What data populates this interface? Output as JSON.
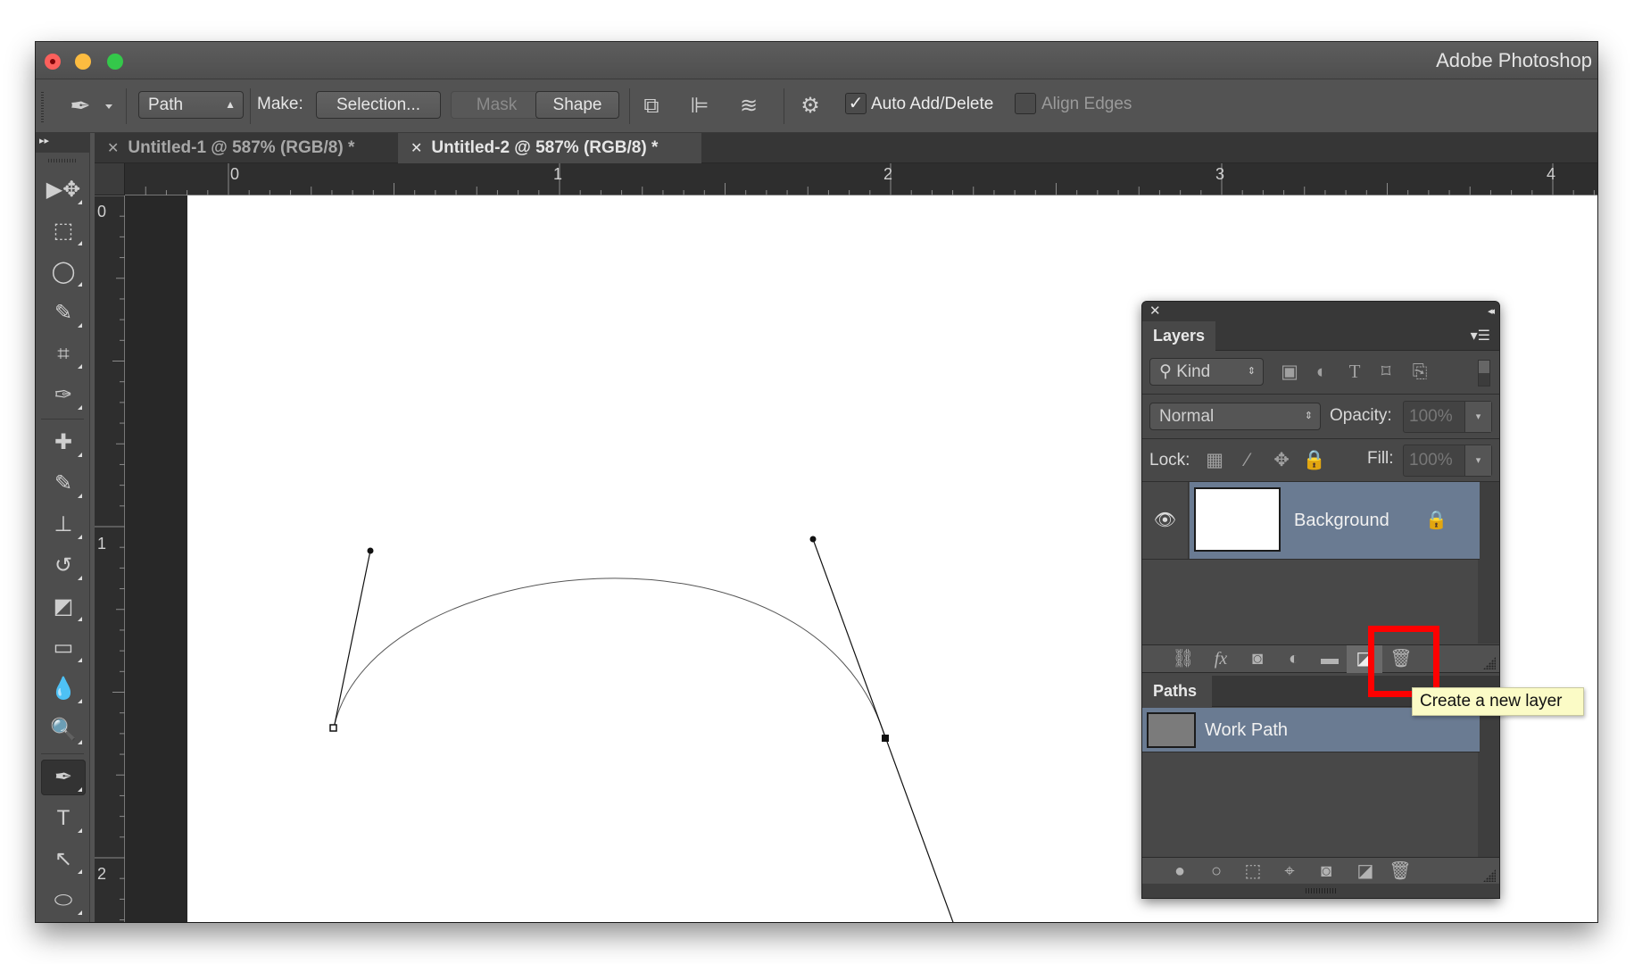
{
  "window": {
    "app_title": "Adobe Photoshop"
  },
  "options_bar": {
    "tool_icon": "pen-icon",
    "mode_select": "Path",
    "make_label": "Make:",
    "selection_button": "Selection...",
    "mask_button": "Mask",
    "shape_button": "Shape",
    "path_operations_icon": "path-operations-icon",
    "path_alignment_icon": "path-alignment-icon",
    "path_arrangement_icon": "path-arrangement-icon",
    "settings_icon": "gear-icon",
    "auto_add_delete": {
      "label": "Auto Add/Delete",
      "checked": true
    },
    "align_edges": {
      "label": "Align Edges",
      "checked": false
    }
  },
  "document_tabs": [
    {
      "label": "Untitled-1 @ 587% (RGB/8) *",
      "active": false
    },
    {
      "label": "Untitled-2 @ 587% (RGB/8) *",
      "active": true
    }
  ],
  "rulers": {
    "horizontal": [
      "0",
      "1",
      "2",
      "3",
      "4"
    ],
    "vertical": [
      "0",
      "1",
      "2"
    ]
  },
  "tools": [
    {
      "name": "move-tool",
      "glyph": "▶✥"
    },
    {
      "name": "rectangular-marquee-tool",
      "glyph": "⬚"
    },
    {
      "name": "lasso-tool",
      "glyph": "◯"
    },
    {
      "name": "quick-selection-tool",
      "glyph": "✎"
    },
    {
      "name": "crop-tool",
      "glyph": "⌗"
    },
    {
      "name": "eyedropper-tool",
      "glyph": "✑"
    },
    {
      "name": "spot-healing-brush-tool",
      "glyph": "✚"
    },
    {
      "name": "brush-tool",
      "glyph": "✎"
    },
    {
      "name": "clone-stamp-tool",
      "glyph": "⊥"
    },
    {
      "name": "history-brush-tool",
      "glyph": "↺"
    },
    {
      "name": "eraser-tool",
      "glyph": "◩"
    },
    {
      "name": "gradient-tool",
      "glyph": "▭"
    },
    {
      "name": "blur-tool",
      "glyph": "💧"
    },
    {
      "name": "dodge-tool",
      "glyph": "🔍"
    },
    {
      "name": "pen-tool",
      "glyph": "✒",
      "active": true
    },
    {
      "name": "type-tool",
      "glyph": "T"
    },
    {
      "name": "path-selection-tool",
      "glyph": "↖"
    },
    {
      "name": "ellipse-tool",
      "glyph": "⬭"
    }
  ],
  "layers_panel": {
    "tab_label": "Layers",
    "filter_kind": "Kind",
    "blend_mode": "Normal",
    "opacity_label": "Opacity:",
    "opacity_value": "100%",
    "lock_label": "Lock:",
    "fill_label": "Fill:",
    "fill_value": "100%",
    "layers": [
      {
        "name": "Background",
        "visible": true,
        "locked": true,
        "selected": true
      }
    ],
    "footer_buttons": [
      "link-layers",
      "add-layer-style",
      "add-layer-mask",
      "new-fill-adjustment-layer",
      "new-group",
      "create-new-layer",
      "delete-layer"
    ],
    "highlighted_button": "create-new-layer"
  },
  "paths_panel": {
    "tab_label": "Paths",
    "paths": [
      {
        "name": "Work Path",
        "selected": true
      }
    ],
    "footer_buttons": [
      "fill-path",
      "stroke-path",
      "load-path-as-selection",
      "make-work-path",
      "add-mask",
      "create-new-path",
      "delete-path"
    ]
  },
  "tooltip": {
    "text": "Create a new layer"
  },
  "annotation": {
    "type": "highlight-box",
    "color": "#ff0000",
    "target": "create-new-layer"
  },
  "canvas_path": {
    "anchors": [
      {
        "type": "start",
        "selected": false
      },
      {
        "type": "end",
        "selected": true
      }
    ],
    "handle_count": 3
  },
  "colors": {
    "selection_row": "#6a7b92",
    "tooltip_bg": "#fbfbc6",
    "highlight": "#ff0000"
  }
}
